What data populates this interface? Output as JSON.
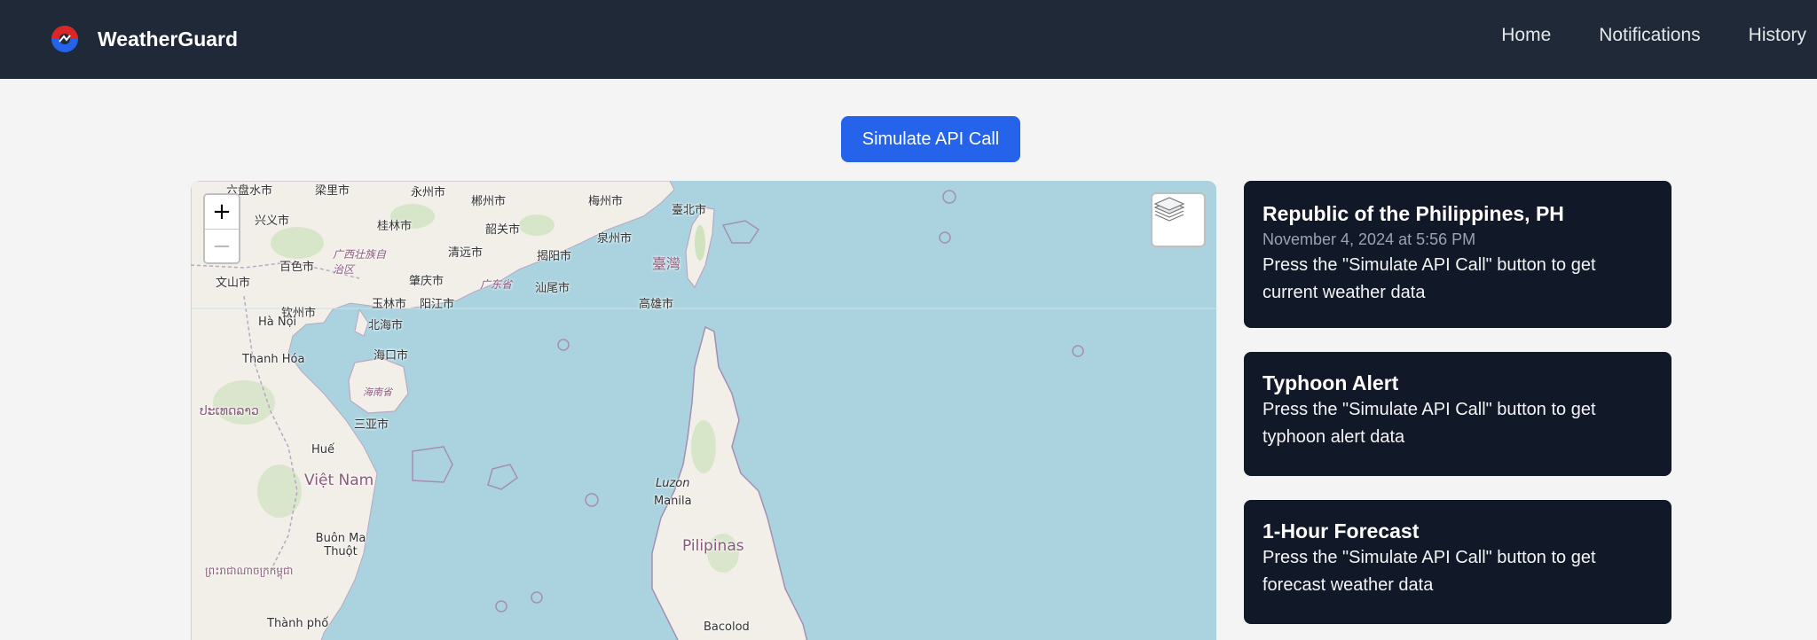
{
  "nav": {
    "brand": "WeatherGuard",
    "links": [
      "Home",
      "Notifications",
      "History"
    ]
  },
  "actions": {
    "simulate_label": "Simulate API Call"
  },
  "map": {
    "zoom_in": "+",
    "zoom_out": "−",
    "labels": {
      "liuzhou": "六盘水市",
      "hezhou": "梁里市",
      "yongzhou": "永州市",
      "chenzhou": "郴州市",
      "xingyi": "兴义市",
      "guilin": "桂林市",
      "shaoguan": "韶关市",
      "meizhou": "梅州市",
      "taipei": "臺北市",
      "quanzhou": "泉州市",
      "baise": "百色市",
      "guangxi": "广西壮族自治区",
      "qingyuan": "清远市",
      "jieyang": "揭阳市",
      "taiwan": "臺灣",
      "wenshan": "文山市",
      "zhaoqing": "肇庆市",
      "guangdong": "广东省",
      "shantou": "汕尾市",
      "hanoi": "Hà Nội",
      "qinzhou": "钦州市",
      "yulin": "玉林市",
      "yangjiang": "阳江市",
      "kaohsiung": "高雄市",
      "beihai": "北海市",
      "haikou": "海口市",
      "thanhhoa": "Thanh Hóa",
      "hainan": "海南省",
      "laos": "ປະເທດລາວ",
      "sanya": "三亚市",
      "hue": "Huế",
      "vietnam": "Việt Nam",
      "luzon": "Luzon",
      "manila": "Manila",
      "buonmathuot": "Buôn Ma Thuột",
      "pilipinas": "Pilipinas",
      "cambodia": "ព្រះរាជាណាចក្រកម្ពុជា",
      "thanhpho": "Thành phố",
      "bacolod": "Bacolod"
    }
  },
  "cards": [
    {
      "title": "Republic of the Philippines, PH",
      "date": "November 4, 2024 at 5:56 PM",
      "body": "Press the \"Simulate API Call\" button to get current weather data"
    },
    {
      "title": "Typhoon Alert",
      "body": "Press the \"Simulate API Call\" button to get typhoon alert data"
    },
    {
      "title": "1-Hour Forecast",
      "body": "Press the \"Simulate API Call\" button to get forecast weather data"
    }
  ],
  "colors": {
    "navbar": "#1f2937",
    "page_bg": "#f5f4f4",
    "accent": "#2563eb",
    "card_bg": "#111827",
    "sea": "#aad3df",
    "land": "#f2efe9"
  }
}
